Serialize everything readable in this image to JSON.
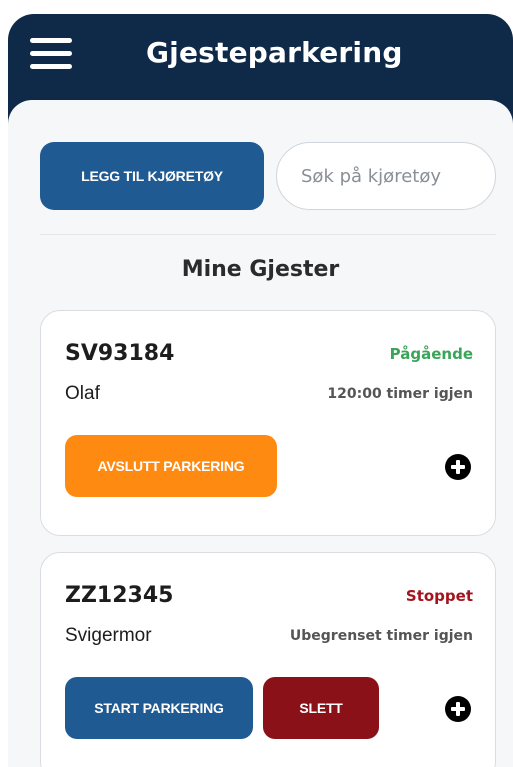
{
  "app": {
    "title": "Gjesteparkering"
  },
  "toolbar": {
    "add_vehicle_label": "LEGG TIL KJØRETØY",
    "search_placeholder": "Søk på kjøretøy"
  },
  "section": {
    "title": "Mine Gjester"
  },
  "colors": {
    "header_bg": "#0e2a48",
    "primary_blue": "#1f5a93",
    "orange": "#ff8a12",
    "danger_red": "#8a1117",
    "status_active": "#3aa55a",
    "status_stopped": "#a3141d"
  },
  "guests": [
    {
      "plate": "SV93184",
      "status": "Pågående",
      "name": "Olaf",
      "time_left": "120:00 timer igjen",
      "primary_action": "AVSLUTT PARKERING",
      "add_icon": "plus-circle-icon"
    },
    {
      "plate": "ZZ12345",
      "status": "Stoppet",
      "name": "Svigermor",
      "time_left": "Ubegrenset timer igjen",
      "primary_action": "START PARKERING",
      "secondary_action": "SLETT",
      "add_icon": "plus-circle-icon"
    }
  ]
}
